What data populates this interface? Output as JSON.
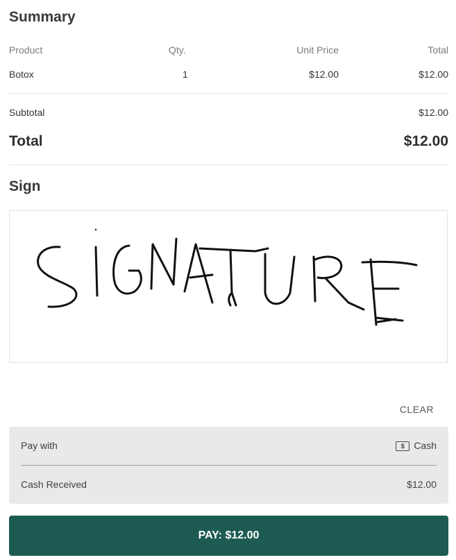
{
  "summary": {
    "title": "Summary",
    "columns": {
      "product": "Product",
      "qty": "Qty.",
      "unit_price": "Unit Price",
      "total": "Total"
    },
    "items": [
      {
        "product": "Botox",
        "qty": "1",
        "unit_price": "$12.00",
        "total": "$12.00"
      }
    ],
    "subtotal_label": "Subtotal",
    "subtotal_value": "$12.00",
    "total_label": "Total",
    "total_value": "$12.00"
  },
  "sign": {
    "title": "Sign",
    "signature_text": "SIGNATURE",
    "clear_label": "CLEAR"
  },
  "payment": {
    "pay_with_label": "Pay with",
    "method_icon": "cash-icon",
    "method_icon_glyph": "$",
    "method_label": "Cash",
    "cash_received_label": "Cash Received",
    "cash_received_value": "$12.00"
  },
  "pay_button": {
    "label": "PAY: $12.00",
    "color": "#1d5b52"
  }
}
